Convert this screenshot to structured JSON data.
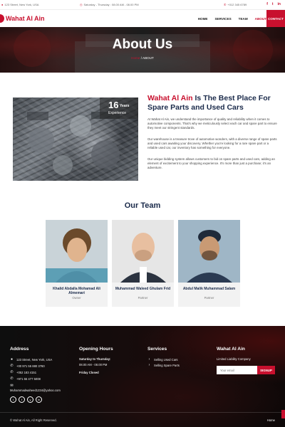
{
  "topbar": {
    "address": "123 Street, New York, USA",
    "hours": "Saturday - Thursday : 08.00 AM - 08.00 PM",
    "phone": "+012 345 6789",
    "social": [
      "f",
      "t",
      "in"
    ]
  },
  "nav": {
    "logo": "Wahat Al Ain",
    "items": [
      "HOME",
      "SERVICES",
      "TEAM",
      "ABOUT"
    ],
    "contact": "CONTACT"
  },
  "hero": {
    "title": "About Us",
    "crumb_home": "Home",
    "crumb_sep": "/",
    "crumb_current": "ABOUT"
  },
  "about": {
    "years_num": "16",
    "years_label": "Years",
    "years_exp": "Experience",
    "title_brand": "Wahat Al Ain",
    "title_rest": "Is The Best Place For Spare Parts and Used Cars",
    "p1": "At Wahat Al Ain, we understand the importance of quality and reliability when it comes to automotive components. That's why we meticulously select each car and spare part to ensure they meet our stringent standards.",
    "p2": "Our warehouse is a treasure trove of automotive wonders, with a diverse range of spare parts and used cars awaiting your discovery. Whether you're looking for a rare spare part or a reliable used car, our inventory has something for everyone.",
    "p3": "Our unique bidding system allows customers to bid on spare parts and used cars, adding an element of excitement to your shopping experience. It's more than just a purchase; it's an adventure."
  },
  "team": {
    "title": "Our Team",
    "members": [
      {
        "name": "Khalid Abdalla Mohamad Ali Almemari",
        "role": "Owner"
      },
      {
        "name": "Muhammad Waleed Ghulam Frid",
        "role": "Partner"
      },
      {
        "name": "Abdul Malik Muhammad Salam",
        "role": "Partner"
      }
    ]
  },
  "footer": {
    "address_title": "Address",
    "address": "123 Street, New York, USA",
    "phone1": "+00 971 55 880 3760",
    "phone2": "+052 183 4151",
    "phone3": "+971 55 477 5008",
    "email": "Muhammadwaheed1234@yahoo.com",
    "hours_title": "Opening Hours",
    "hours_days": "Saturday to Thursday:",
    "hours_time": "08.00 AM - 08.00 PM",
    "hours_closed": "Friday Closed",
    "services_title": "Services",
    "services": [
      "Selling Used Cars",
      "Selling Spare Parts"
    ],
    "company_title": "Wahat Al Ain",
    "company_sub": "Limited Liability Company",
    "email_placeholder": "Your email",
    "signup": "SIGNUP",
    "social": [
      "t",
      "f",
      "y",
      "in"
    ],
    "copyright": "© Wahat Al Ain, All Right Reserved.",
    "home_link": "Home"
  },
  "colors": {
    "accent": "#c8102e",
    "heading": "#1a2a4a"
  }
}
